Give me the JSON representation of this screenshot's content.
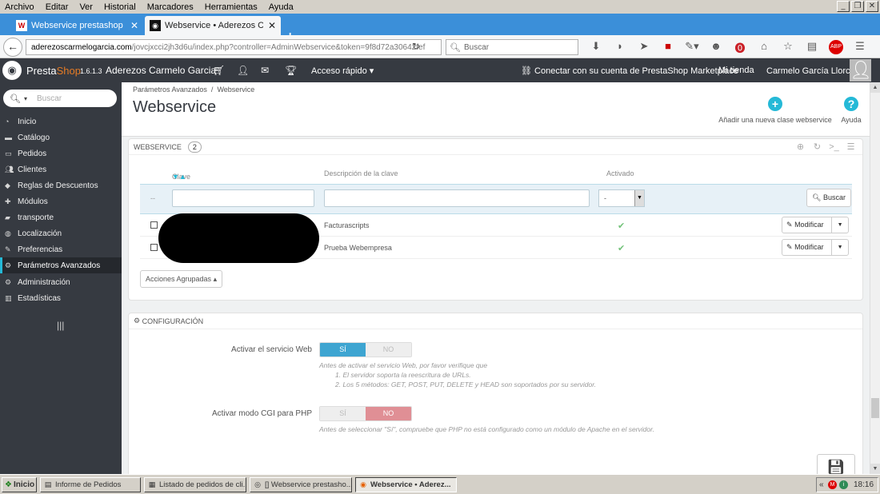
{
  "browser": {
    "menu": [
      "Archivo",
      "Editar",
      "Ver",
      "Historial",
      "Marcadores",
      "Herramientas",
      "Ayuda"
    ],
    "tabs": [
      {
        "title": "Webservice prestashop 1.6.1...",
        "active": false
      },
      {
        "title": "Webservice • Aderezos Carm...",
        "active": true
      }
    ],
    "url_domain": "aderezoscarmelogarcia.com",
    "url_path": "/jovcjxcci2jh3d6u/index.php?controller=AdminWebservice&token=9f8d72a30642fef",
    "search_placeholder": "Buscar"
  },
  "ps_header": {
    "brand_presta": "Presta",
    "brand_shop": "Shop",
    "version": "1.6.1.3",
    "store": "Aderezos Carmelo Garcia",
    "quick_access": "Acceso rápido",
    "marketplace": "Conectar con su cuenta de PrestaShop Marketplace",
    "my_store": "Mi tienda",
    "user": "Carmelo García Llorca"
  },
  "sidebar": {
    "search_placeholder": "Buscar",
    "items": [
      {
        "label": "Inicio",
        "icon": "tachometer-icon",
        "active": false
      },
      {
        "label": "Catálogo",
        "icon": "book-icon",
        "active": false
      },
      {
        "label": "Pedidos",
        "icon": "credit-card-icon",
        "active": false
      },
      {
        "label": "Clientes",
        "icon": "users-icon",
        "active": false
      },
      {
        "label": "Reglas de Descuentos",
        "icon": "tags-icon",
        "active": false
      },
      {
        "label": "Módulos",
        "icon": "puzzle-icon",
        "active": false
      },
      {
        "label": "transporte",
        "icon": "truck-icon",
        "active": false
      },
      {
        "label": "Localización",
        "icon": "globe-icon",
        "active": false
      },
      {
        "label": "Preferencias",
        "icon": "wrench-icon",
        "active": false
      },
      {
        "label": "Parámetros Avanzados",
        "icon": "cogs-icon",
        "active": true
      },
      {
        "label": "Administración",
        "icon": "cog-icon",
        "active": false
      },
      {
        "label": "Estadísticas",
        "icon": "bar-chart-icon",
        "active": false
      }
    ]
  },
  "page": {
    "breadcrumb_1": "Parámetros Avanzados",
    "breadcrumb_sep": "/",
    "breadcrumb_2": "Webservice",
    "title": "Webservice",
    "add_label": "Añadir una nueva clase webservice",
    "help_label": "Ayuda"
  },
  "webservice_panel": {
    "heading": "Webservice",
    "count": "2",
    "columns": {
      "key": "Clave",
      "description": "Descripción de la clave",
      "active": "Activado"
    },
    "filter": {
      "dash": "--",
      "select_value": "-",
      "search_button": "Buscar"
    },
    "rows": [
      {
        "description": "Facturascripts",
        "active": true,
        "action": "Modificar"
      },
      {
        "description": "Prueba Webempresa",
        "active": true,
        "action": "Modificar"
      }
    ],
    "bulk_actions": "Acciones Agrupadas"
  },
  "config_panel": {
    "heading": "Configuración",
    "webservice_label": "Activar el servicio Web",
    "yes": "SÍ",
    "no": "NO",
    "webservice_help_1": "Antes de activar el servicio Web, por favor verifique que",
    "webservice_help_2": "1. El servidor soporta la reescritura de URLs.",
    "webservice_help_3": "2. Los 5 métodos: GET, POST, PUT, DELETE y HEAD son soportados por su servidor.",
    "cgi_label": "Activar modo CGI para PHP",
    "cgi_yes": "SÍ",
    "cgi_no": "NO",
    "cgi_help": "Antes de seleccionar \"Sí\", compruebe que PHP no está configurado como un módulo de Apache en el servidor."
  },
  "taskbar": {
    "start": "Inicio",
    "items": [
      {
        "label": "Informe de Pedidos",
        "active": false
      },
      {
        "label": "Listado de pedidos de cli...",
        "active": false
      },
      {
        "label": "[] Webservice prestasho...",
        "active": false
      },
      {
        "label": "Webservice • Aderez...",
        "active": true
      }
    ],
    "clock": "18:16"
  },
  "colors": {
    "accent": "#25b9d7",
    "sidebar_bg": "#363a41",
    "switch_on": "#3ea5d1",
    "switch_no_active": "#e08f95",
    "check_green": "#72c279"
  }
}
